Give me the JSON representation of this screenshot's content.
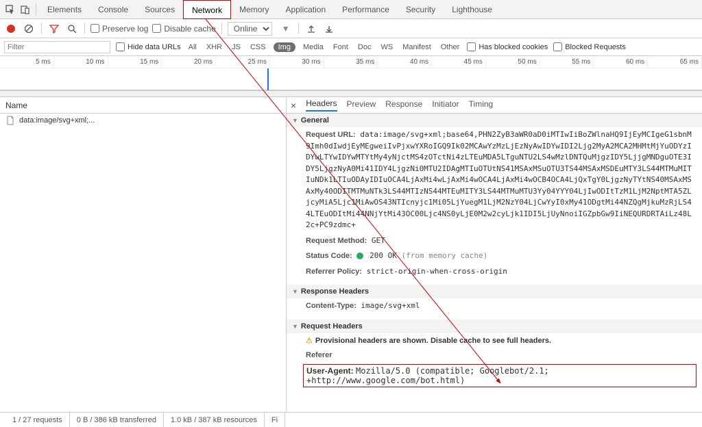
{
  "topTabs": {
    "items": [
      "Elements",
      "Console",
      "Sources",
      "Network",
      "Memory",
      "Application",
      "Performance",
      "Security",
      "Lighthouse"
    ],
    "active": "Network"
  },
  "toolbar": {
    "preserveLog": "Preserve log",
    "disableCache": "Disable cache",
    "throttle": "Online"
  },
  "filterBar": {
    "placeholder": "Filter",
    "hideDataUrls": "Hide data URLs",
    "types": [
      "All",
      "XHR",
      "JS",
      "CSS",
      "Img",
      "Media",
      "Font",
      "Doc",
      "WS",
      "Manifest",
      "Other"
    ],
    "activeType": "Img",
    "hasBlocked": "Has blocked cookies",
    "blockedReq": "Blocked Requests"
  },
  "timeline": {
    "ticks": [
      "5 ms",
      "10 ms",
      "15 ms",
      "20 ms",
      "25 ms",
      "30 ms",
      "35 ms",
      "40 ms",
      "45 ms",
      "50 ms",
      "55 ms",
      "60 ms",
      "65 ms"
    ]
  },
  "leftHeader": "Name",
  "requestRow": "data:image/svg+xml;...",
  "rightTabs": [
    "Headers",
    "Preview",
    "Response",
    "Initiator",
    "Timing"
  ],
  "rightActive": "Headers",
  "sections": {
    "general": {
      "title": "General",
      "requestUrlLabel": "Request URL:",
      "requestUrlValue": "data:image/svg+xml;base64,PHN2ZyB3aWR0aD0iMTIwIiBoZWlnaHQ9IjEyMCIgeG1sbnM9Imh0dIwdjEyMEgweiIvPjxwYXRoIGQ9Ik02MCAwYzMzLjEzNyAwIDYwIDI2Ljg2MyA2MCA2MHMtMjYuODYzIDYwLTYwIDYwMTYtMy4yNjctMS4zOTctNi4zLTEuMDA5LTguNTU2LS4wMzlDNTQuMjgzIDY5LjjgMNDguOTE3IDY5LjgzNyA0Mi41IDY4LjgzNi0MTU2IDAgMTIuOTUtNS41MSAxMSuOTU3TS44MSAxMSDEuMTY3LS44MTMuMITIuNDk1LTIuODAyIDIuOCA4LjAxMi4wLjAxMi4wOCA4LjAxMi4wOCB4OCA4LjQxTgY0LjgzNyTYtNS40MSAxMSAxMy40ODITMTMuNTk3LS44MTIzNS44MTEuMITY3LS44MTMuMTU3Yy04YYY04LjIwODItTzM1LjM2NptMTA5ZLjcyMiA5Ljc1MiAwOS43NTIcnyjc1Mi05LjYuegM1LjM2NzY04LjCwYyI0xMy41ODgtMi44NZQgMjkuMzRjLS44LTEuODItMi44NNjYtMi43OC00Ljc4NS0yLjE0M2w2cyLjk1IDI5LjUyNnoiIGZpbGw9IiNEQURDRTAiLz48L2c+PC9zdmc+",
      "methodLabel": "Request Method:",
      "methodValue": "GET",
      "statusLabel": "Status Code:",
      "statusValue": "200 OK",
      "statusNote": "(from memory cache)",
      "referrerLabel": "Referrer Policy:",
      "referrerValue": "strict-origin-when-cross-origin"
    },
    "responseHeaders": {
      "title": "Response Headers",
      "contentTypeLabel": "Content-Type:",
      "contentTypeValue": "image/svg+xml"
    },
    "requestHeaders": {
      "title": "Request Headers",
      "warning": "Provisional headers are shown. Disable cache to see full headers.",
      "refererLabel": "Referer",
      "uaLabel": "User-Agent:",
      "uaValue": "Mozilla/5.0 (compatible; Googlebot/2.1; +http://www.google.com/bot.html)"
    }
  },
  "statusBar": {
    "requests": "1 / 27 requests",
    "transferred": "0 B / 386 kB transferred",
    "resources": "1.0 kB / 387 kB resources",
    "finish": "Fi"
  }
}
